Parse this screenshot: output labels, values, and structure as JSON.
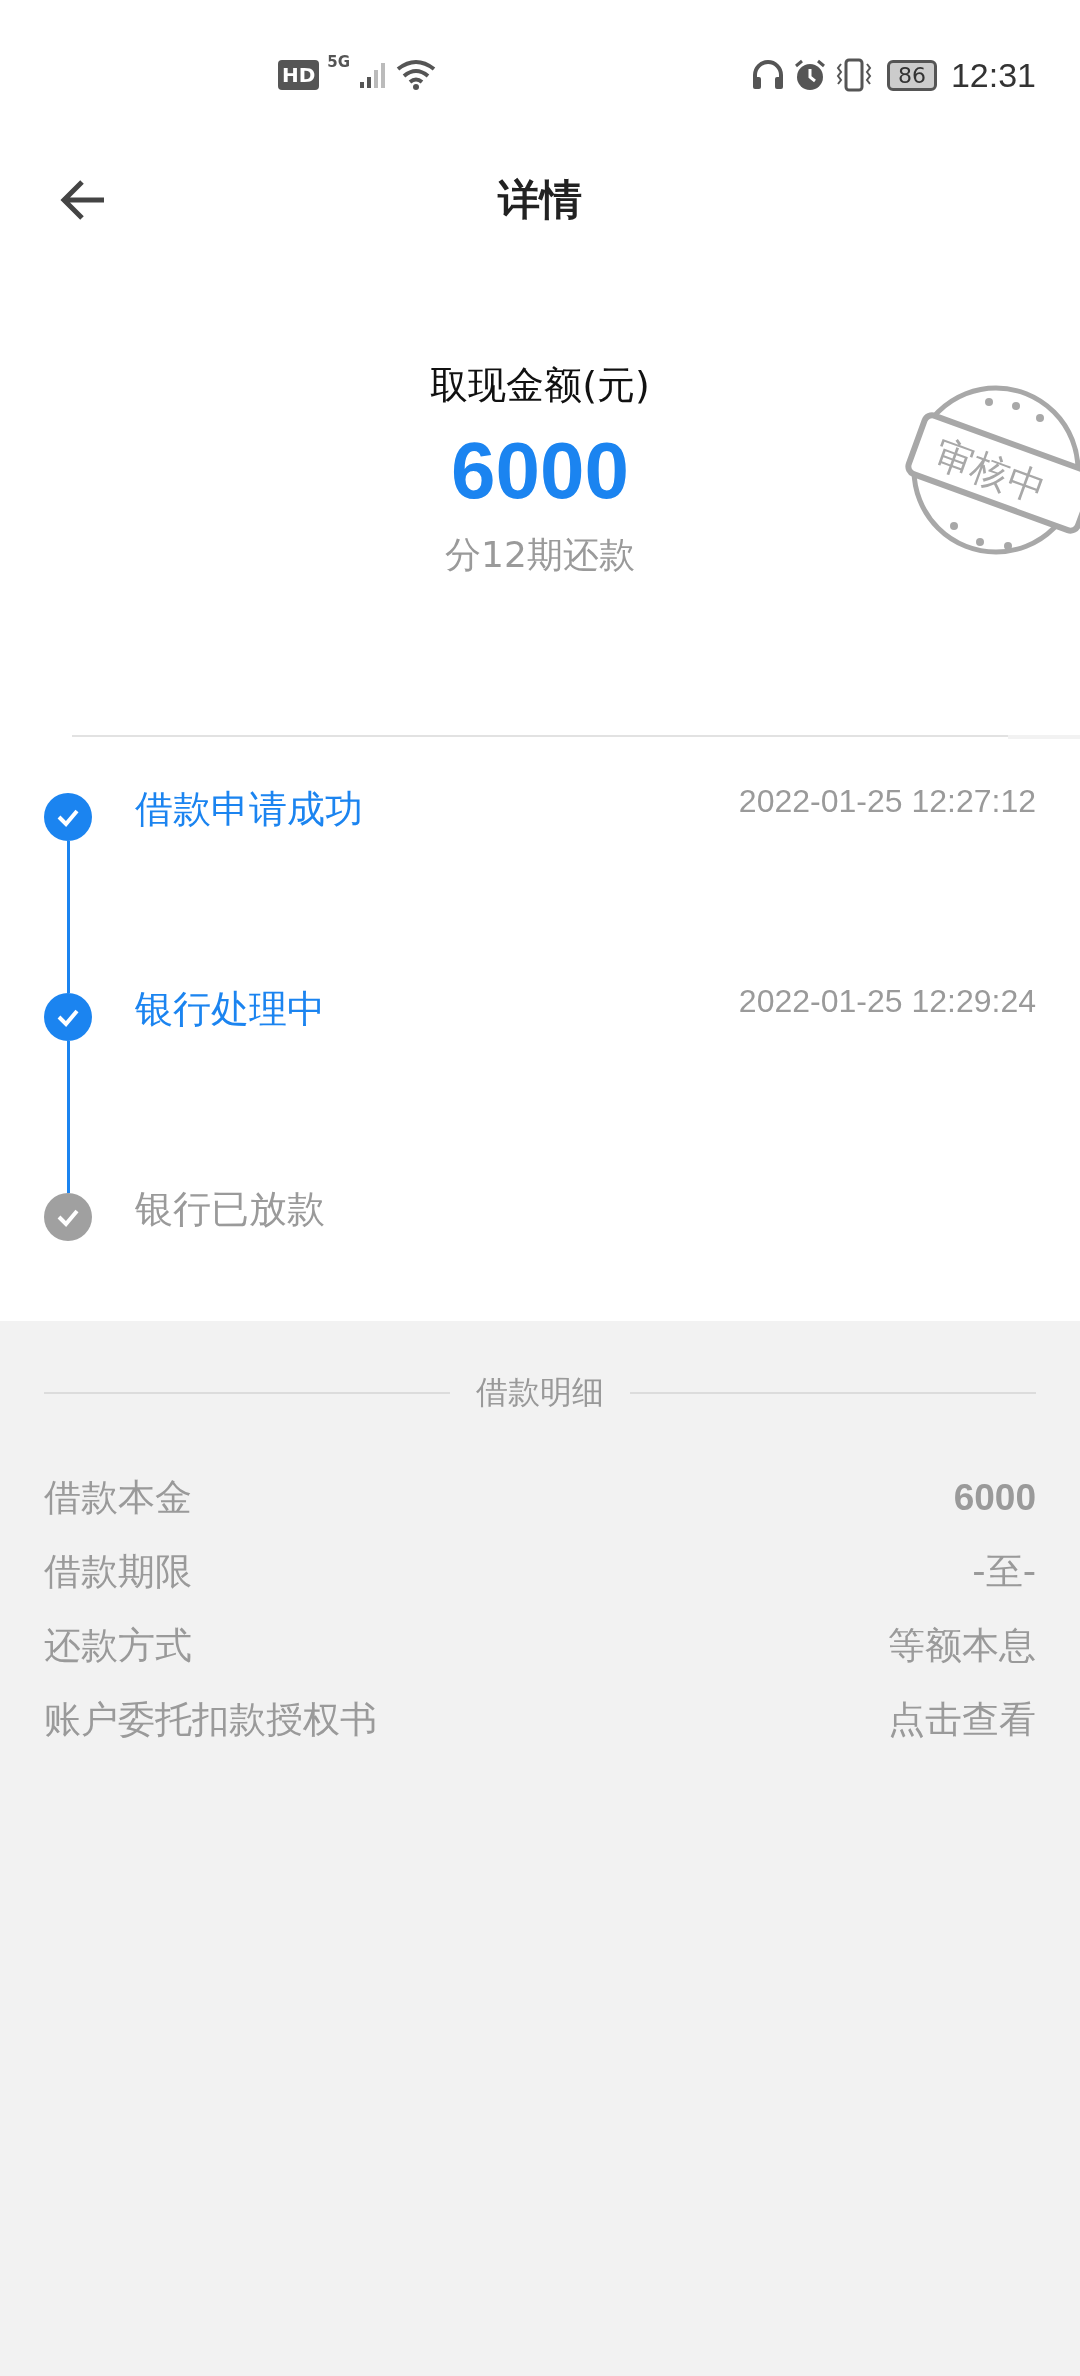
{
  "status_bar": {
    "hd": "HD",
    "network": "5G",
    "battery": "86",
    "time": "12:31"
  },
  "header": {
    "title": "详情"
  },
  "summary": {
    "label": "取现金额(元)",
    "amount": "6000",
    "installments": "分12期还款",
    "stamp": "审核中"
  },
  "steps": [
    {
      "title": "借款申请成功",
      "time": "2022-01-25 12:27:12",
      "done": true
    },
    {
      "title": "银行处理中",
      "time": "2022-01-25 12:29:24",
      "done": true
    },
    {
      "title": "银行已放款",
      "done": false
    }
  ],
  "details": {
    "heading": "借款明细",
    "rows": [
      {
        "label": "借款本金",
        "value": "6000",
        "kind": "number"
      },
      {
        "label": "借款期限",
        "value": "-至-",
        "kind": "text"
      },
      {
        "label": "还款方式",
        "value": "等额本息",
        "kind": "text"
      },
      {
        "label": "账户委托扣款授权书",
        "value": "点击查看",
        "kind": "link"
      }
    ]
  }
}
